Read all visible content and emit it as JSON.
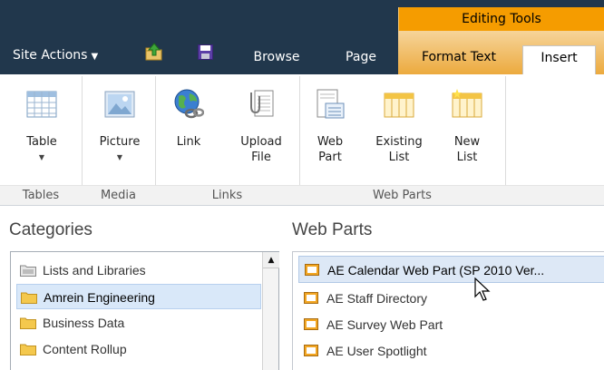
{
  "header": {
    "site_actions": "Site Actions",
    "editing_tools": "Editing Tools",
    "tabs": [
      "Browse",
      "Page",
      "Format Text",
      "Insert"
    ]
  },
  "ribbon": {
    "buttons": [
      {
        "label": "Table",
        "dropdown": true,
        "icon": "table-icon"
      },
      {
        "label": "Picture",
        "dropdown": true,
        "icon": "picture-icon"
      },
      {
        "label": "Link",
        "dropdown": false,
        "icon": "link-icon"
      },
      {
        "label": "Upload\nFile",
        "dropdown": false,
        "icon": "upload-file-icon"
      },
      {
        "label": "Web\nPart",
        "dropdown": false,
        "icon": "web-part-icon"
      },
      {
        "label": "Existing\nList",
        "dropdown": false,
        "icon": "existing-list-icon"
      },
      {
        "label": "New\nList",
        "dropdown": false,
        "icon": "new-list-icon"
      }
    ],
    "groups": [
      "Tables",
      "Media",
      "Links",
      "Web Parts"
    ]
  },
  "categories": {
    "title": "Categories",
    "items": [
      "Lists and Libraries",
      "Amrein Engineering",
      "Business Data",
      "Content Rollup"
    ],
    "selected": "Amrein Engineering"
  },
  "web_parts": {
    "title": "Web Parts",
    "items": [
      "AE Calendar Web Part (SP 2010 Ver...",
      "AE Staff Directory",
      "AE Survey Web Part",
      "AE User Spotlight"
    ],
    "selected": "AE Calendar Web Part (SP 2010 Ver..."
  },
  "colors": {
    "top_bar": "#21374c",
    "editing_tools": "#f59c00",
    "selection": "#d9e8f9"
  }
}
